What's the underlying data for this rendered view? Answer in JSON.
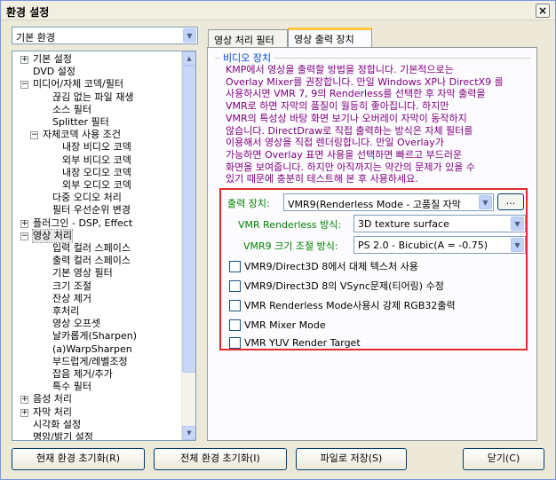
{
  "window": {
    "title": "환경 설정"
  },
  "left_combo": {
    "value": "기본 환경"
  },
  "tree": {
    "items": [
      {
        "label": "기본 설정",
        "expander": "+"
      },
      {
        "label": "DVD 설정",
        "expander": ""
      },
      {
        "label": "미디어/자체 코덱/필터",
        "expander": "−"
      },
      {
        "label": "끊김 없는 파일 재생",
        "expander": ""
      },
      {
        "label": "소스 필터",
        "expander": ""
      },
      {
        "label": "Splitter 필터",
        "expander": ""
      },
      {
        "label": "자체코덱 사용 조건",
        "expander": "−"
      },
      {
        "label": "내장 비디오 코덱",
        "expander": ""
      },
      {
        "label": "외부 비디오 코덱",
        "expander": ""
      },
      {
        "label": "내장 오디오 코덱",
        "expander": ""
      },
      {
        "label": "외부 오디오 코덱",
        "expander": ""
      },
      {
        "label": "다중 오디오 처리",
        "expander": ""
      },
      {
        "label": "필터 우선순위 변경",
        "expander": ""
      },
      {
        "label": "플러그인 - DSP, Effect",
        "expander": "+"
      },
      {
        "label": "영상 처리",
        "expander": "−"
      },
      {
        "label": "입력 컬러 스페이스",
        "expander": ""
      },
      {
        "label": "출력 컬러 스페이스",
        "expander": ""
      },
      {
        "label": "기본 영상 필터",
        "expander": ""
      },
      {
        "label": "크기 조절",
        "expander": ""
      },
      {
        "label": "잔상 제거",
        "expander": ""
      },
      {
        "label": "후처리",
        "expander": ""
      },
      {
        "label": "영상 오프셋",
        "expander": ""
      },
      {
        "label": "날카롭게(Sharpen)",
        "expander": ""
      },
      {
        "label": "(a)WarpSharpen",
        "expander": ""
      },
      {
        "label": "부드럽게/레벨조정",
        "expander": ""
      },
      {
        "label": "잡음 제거/추가",
        "expander": ""
      },
      {
        "label": "특수 필터",
        "expander": ""
      },
      {
        "label": "음성 처리",
        "expander": "+"
      },
      {
        "label": "자막 처리",
        "expander": "+"
      },
      {
        "label": "시각화 설정",
        "expander": ""
      },
      {
        "label": "명암/밝기 설정",
        "expander": ""
      }
    ]
  },
  "tabs": [
    {
      "label": "영상 처리 필터"
    },
    {
      "label": "영상 출력 장치"
    }
  ],
  "video_device": {
    "group_title": "비디오 장치",
    "description": [
      "KMP에서 영상을 출력할 방법을 정합니다. 기본적으로는",
      "Overlay Mixer를 권장합니다. 만일 Windows XP나 DirectX9 를",
      "사용하시면 VMR 7, 9의 Renderless를 선택한 후 자막 출력을",
      "VMR로 하면 자막의 품질이 월등히 좋아집니다. 하지만",
      "VMR의 특성상 바탕 화면 보기나 오버레이 자막이 동작하지",
      "않습니다. DirectDraw로 직접 출력하는 방식은 자체 필터를",
      "이용해서 영상을 직접 렌더링합니다.  만일 Overlay가",
      "가능하면 Overlay 표면 사용을 선택하면 빠르고 부드러운",
      "화면을 보여줍니다.  하지만 아직까지는 약간의 문제가 있을 수",
      "있기 때문에 충분히 테스트해 본 후 사용하세요."
    ],
    "output_label": "출력 장치:",
    "output_value": "VMR9(Renderless Mode - 고품질 자막",
    "more_button": "...",
    "renderless_label": "VMR Renderless 방식:",
    "renderless_value": "3D texture surface",
    "resize_label": "VMR9 크기 조절 방식:",
    "resize_value": "PS 2.0 - Bicubic(A = -0.75)",
    "checkboxes": [
      {
        "label": "VMR9/Direct3D 8에서 대체 텍스처 사용",
        "checked": false
      },
      {
        "label": "VMR9/Direct3D 8의 VSync문제(티어링) 수정",
        "checked": false
      },
      {
        "label": "VMR Renderless Mode사용시 강제 RGB32출력",
        "checked": false
      },
      {
        "label": "VMR Mixer Mode",
        "checked": false
      },
      {
        "label": "VMR YUV Render Target",
        "checked": false
      }
    ]
  },
  "buttons": {
    "reset_current": "현재 환경 초기화(R)",
    "reset_all": "전체 환경 초기화(I)",
    "save_file": "파일로 저장(S)",
    "close": "닫기(C)"
  }
}
